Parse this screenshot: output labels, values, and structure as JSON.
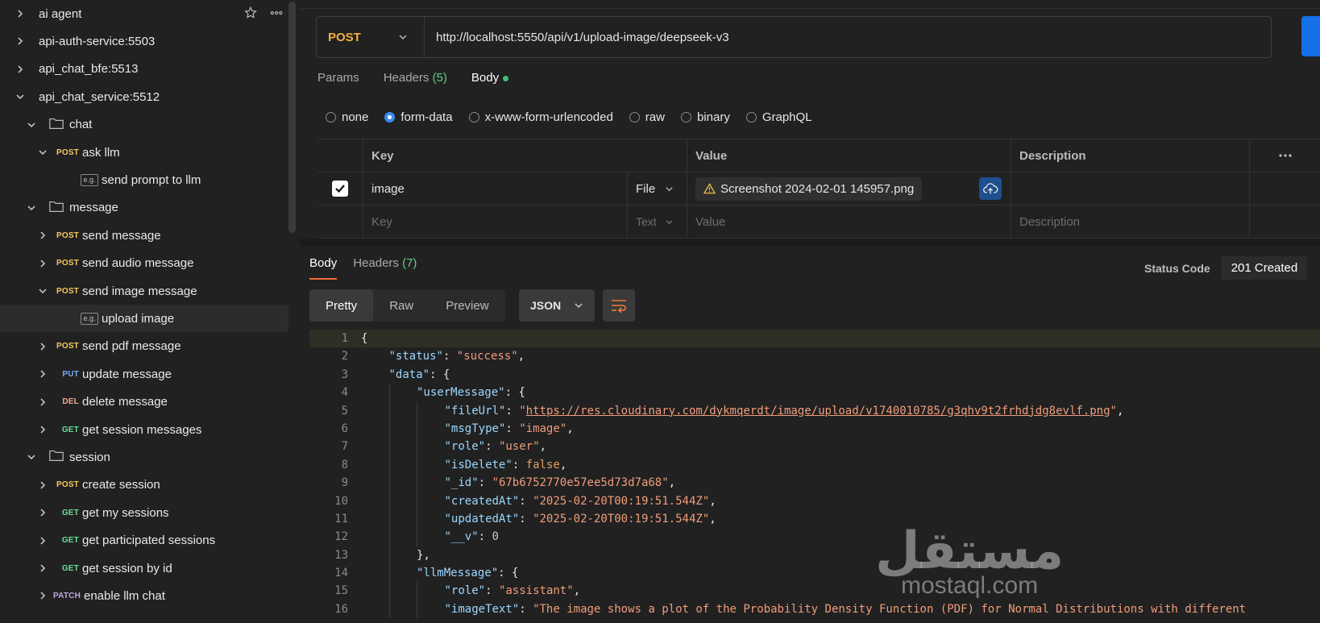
{
  "sidebar": {
    "items": [
      {
        "label": "ai agent",
        "expanded": false,
        "depth": 0
      },
      {
        "label": "api-auth-service:5503",
        "expanded": false,
        "depth": 0
      },
      {
        "label": "api_chat_bfe:5513",
        "expanded": false,
        "depth": 0
      },
      {
        "label": "api_chat_service:5512",
        "expanded": true,
        "depth": 0
      },
      {
        "label": "chat",
        "type": "folder",
        "expanded": true,
        "depth": 1
      },
      {
        "label": "ask llm",
        "method": "POST",
        "expanded": true,
        "depth": 2
      },
      {
        "label": "send prompt to llm",
        "type": "example",
        "depth": 3
      },
      {
        "label": "message",
        "type": "folder",
        "expanded": true,
        "depth": 1
      },
      {
        "label": "send message",
        "method": "POST",
        "expanded": false,
        "depth": 2
      },
      {
        "label": "send audio message",
        "method": "POST",
        "expanded": false,
        "depth": 2
      },
      {
        "label": "send image message",
        "method": "POST",
        "expanded": true,
        "depth": 2
      },
      {
        "label": "upload image",
        "type": "example",
        "depth": 3,
        "active": true
      },
      {
        "label": "send pdf message",
        "method": "POST",
        "expanded": false,
        "depth": 2
      },
      {
        "label": "update message",
        "method": "PUT",
        "expanded": false,
        "depth": 2
      },
      {
        "label": "delete message",
        "method": "DEL",
        "expanded": false,
        "depth": 2
      },
      {
        "label": "get session messages",
        "method": "GET",
        "expanded": false,
        "depth": 2
      },
      {
        "label": "session",
        "type": "folder",
        "expanded": true,
        "depth": 1
      },
      {
        "label": "create session",
        "method": "POST",
        "expanded": false,
        "depth": 2
      },
      {
        "label": "get my sessions",
        "method": "GET",
        "expanded": false,
        "depth": 2
      },
      {
        "label": "get participated sessions",
        "method": "GET",
        "expanded": false,
        "depth": 2
      },
      {
        "label": "get session by id",
        "method": "GET",
        "expanded": false,
        "depth": 2
      },
      {
        "label": "enable llm chat",
        "method": "PATCH",
        "expanded": false,
        "depth": 2
      }
    ],
    "example_badge": "e.g."
  },
  "request": {
    "method": "POST",
    "url": "http://localhost:5550/api/v1/upload-image/deepseek-v3",
    "tabs": {
      "params": "Params",
      "headers": "Headers",
      "headers_count": "(5)",
      "body": "Body"
    },
    "body_types": [
      "none",
      "form-data",
      "x-www-form-urlencoded",
      "raw",
      "binary",
      "GraphQL"
    ],
    "selected_body_type": "form-data",
    "table": {
      "headers": {
        "key": "Key",
        "value": "Value",
        "description": "Description"
      },
      "row": {
        "key": "image",
        "type": "File",
        "value": "Screenshot 2024-02-01 145957.png",
        "checked": true
      },
      "placeholder": {
        "key": "Key",
        "type": "Text",
        "value": "Value",
        "description": "Description"
      }
    }
  },
  "response": {
    "tabs": {
      "body": "Body",
      "headers": "Headers",
      "headers_count": "(7)"
    },
    "status_label": "Status Code",
    "status_value": "201 Created",
    "view_tabs": [
      "Pretty",
      "Raw",
      "Preview"
    ],
    "format": "JSON"
  },
  "code_lines": [
    {
      "n": "1",
      "indent": 0,
      "parts": [
        [
          "p",
          "{"
        ]
      ]
    },
    {
      "n": "2",
      "indent": 1,
      "parts": [
        [
          "k",
          "\"status\""
        ],
        [
          "p",
          ": "
        ],
        [
          "s",
          "\"success\""
        ],
        [
          "p",
          ","
        ]
      ]
    },
    {
      "n": "3",
      "indent": 1,
      "parts": [
        [
          "k",
          "\"data\""
        ],
        [
          "p",
          ": {"
        ]
      ]
    },
    {
      "n": "4",
      "indent": 2,
      "parts": [
        [
          "k",
          "\"userMessage\""
        ],
        [
          "p",
          ": {"
        ]
      ]
    },
    {
      "n": "5",
      "indent": 3,
      "parts": [
        [
          "k",
          "\"fileUrl\""
        ],
        [
          "p",
          ": "
        ],
        [
          "s",
          "\""
        ],
        [
          "u",
          "https://res.cloudinary.com/dykmqerdt/image/upload/v1740010785/g3qhv9t2frhdjdg8evlf.png"
        ],
        [
          "s",
          "\""
        ],
        [
          "p",
          ","
        ]
      ]
    },
    {
      "n": "6",
      "indent": 3,
      "parts": [
        [
          "k",
          "\"msgType\""
        ],
        [
          "p",
          ": "
        ],
        [
          "s",
          "\"image\""
        ],
        [
          "p",
          ","
        ]
      ]
    },
    {
      "n": "7",
      "indent": 3,
      "parts": [
        [
          "k",
          "\"role\""
        ],
        [
          "p",
          ": "
        ],
        [
          "s",
          "\"user\""
        ],
        [
          "p",
          ","
        ]
      ]
    },
    {
      "n": "8",
      "indent": 3,
      "parts": [
        [
          "k",
          "\"isDelete\""
        ],
        [
          "p",
          ": "
        ],
        [
          "kw",
          "false"
        ],
        [
          "p",
          ","
        ]
      ]
    },
    {
      "n": "9",
      "indent": 3,
      "parts": [
        [
          "k",
          "\"_id\""
        ],
        [
          "p",
          ": "
        ],
        [
          "s",
          "\"67b6752770e57ee5d73d7a68\""
        ],
        [
          "p",
          ","
        ]
      ]
    },
    {
      "n": "10",
      "indent": 3,
      "parts": [
        [
          "k",
          "\"createdAt\""
        ],
        [
          "p",
          ": "
        ],
        [
          "s",
          "\"2025-02-20T00:19:51.544Z\""
        ],
        [
          "p",
          ","
        ]
      ]
    },
    {
      "n": "11",
      "indent": 3,
      "parts": [
        [
          "k",
          "\"updatedAt\""
        ],
        [
          "p",
          ": "
        ],
        [
          "s",
          "\"2025-02-20T00:19:51.544Z\""
        ],
        [
          "p",
          ","
        ]
      ]
    },
    {
      "n": "12",
      "indent": 3,
      "parts": [
        [
          "k",
          "\"__v\""
        ],
        [
          "p",
          ": "
        ],
        [
          "n",
          "0"
        ]
      ]
    },
    {
      "n": "13",
      "indent": 2,
      "parts": [
        [
          "p",
          "},"
        ]
      ]
    },
    {
      "n": "14",
      "indent": 2,
      "parts": [
        [
          "k",
          "\"llmMessage\""
        ],
        [
          "p",
          ": {"
        ]
      ]
    },
    {
      "n": "15",
      "indent": 3,
      "parts": [
        [
          "k",
          "\"role\""
        ],
        [
          "p",
          ": "
        ],
        [
          "s",
          "\"assistant\""
        ],
        [
          "p",
          ","
        ]
      ]
    },
    {
      "n": "16",
      "indent": 3,
      "parts": [
        [
          "k",
          "\"imageText\""
        ],
        [
          "p",
          ": "
        ],
        [
          "s",
          "\"The image shows a plot of the Probability Density Function (PDF) for Normal Distributions with different"
        ]
      ]
    }
  ],
  "watermark": {
    "arabic": "مستقل",
    "latin": "mostaql.com"
  }
}
